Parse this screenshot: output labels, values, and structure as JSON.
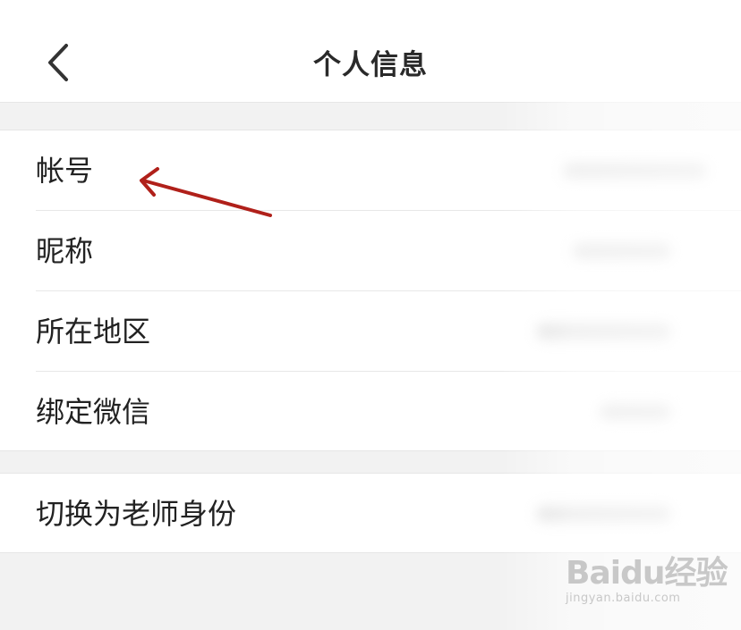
{
  "header": {
    "title": "个人信息",
    "back_icon": "chevron-left-icon"
  },
  "info_group": {
    "items": [
      {
        "label": "帐号"
      },
      {
        "label": "昵称"
      },
      {
        "label": "所在地区"
      },
      {
        "label": "绑定微信"
      }
    ]
  },
  "role_group": {
    "items": [
      {
        "label": "切换为老师身份"
      }
    ]
  },
  "annotation": {
    "arrow_color": "#b0201a"
  },
  "watermark": {
    "logo_text": "Baidu经验",
    "url": "jingyan.baidu.com"
  }
}
